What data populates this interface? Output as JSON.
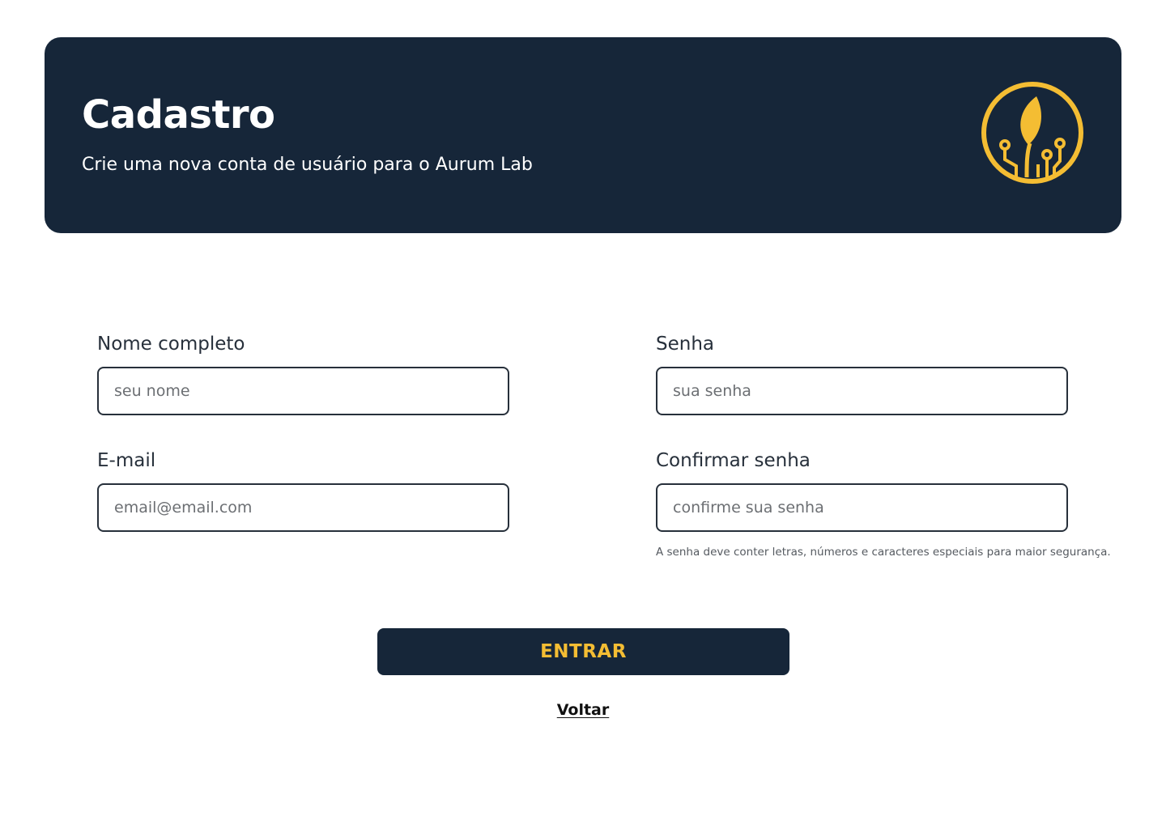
{
  "header": {
    "title": "Cadastro",
    "subtitle": "Crie uma nova conta de usuário para o Aurum Lab",
    "logo_icon": "leaf-circuit-logo-icon"
  },
  "form": {
    "name": {
      "label": "Nome completo",
      "placeholder": "seu nome",
      "value": ""
    },
    "email": {
      "label": "E-mail",
      "placeholder": "email@email.com",
      "value": ""
    },
    "password": {
      "label": "Senha",
      "placeholder": "sua senha",
      "value": ""
    },
    "confirm_password": {
      "label": "Confirmar senha",
      "placeholder": "confirme sua senha",
      "value": ""
    },
    "password_hint": "A senha deve conter letras, números e caracteres especiais para maior segurança."
  },
  "actions": {
    "submit_label": "ENTRAR",
    "back_label": "Voltar"
  },
  "colors": {
    "navy": "#162639",
    "gold": "#F4BD33",
    "text": "#27303B",
    "background": "#FFFFFF"
  }
}
